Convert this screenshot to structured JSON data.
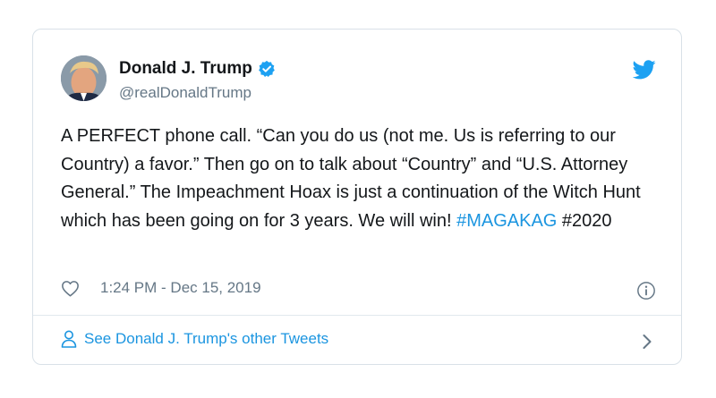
{
  "tweet": {
    "author": {
      "display_name": "Donald J. Trump",
      "handle": "@realDonaldTrump",
      "verified": true
    },
    "text_plain": "A PERFECT phone call. “Can you do us (not me. Us is referring to our Country) a favor.” Then go on to talk about “Country” and “U.S. Attorney General.” The Impeachment Hoax is just a continuation of the Witch Hunt which has been going on for 3 years. We will win! ",
    "hashtag_1": "#MAGAKAG",
    "hashtag_2": "#2020",
    "timestamp": "1:24 PM - Dec 15, 2019"
  },
  "footer": {
    "other_tweets_label": "See Donald J. Trump's other Tweets"
  },
  "colors": {
    "link": "#1b95e0",
    "text": "#14171a",
    "muted": "#657786",
    "border": "#d9e1e8"
  },
  "icons": {
    "brand": "twitter-bird-icon",
    "verified": "verified-badge-icon",
    "like": "heart-icon",
    "info": "info-icon",
    "person": "person-icon",
    "chevron": "chevron-right-icon"
  }
}
